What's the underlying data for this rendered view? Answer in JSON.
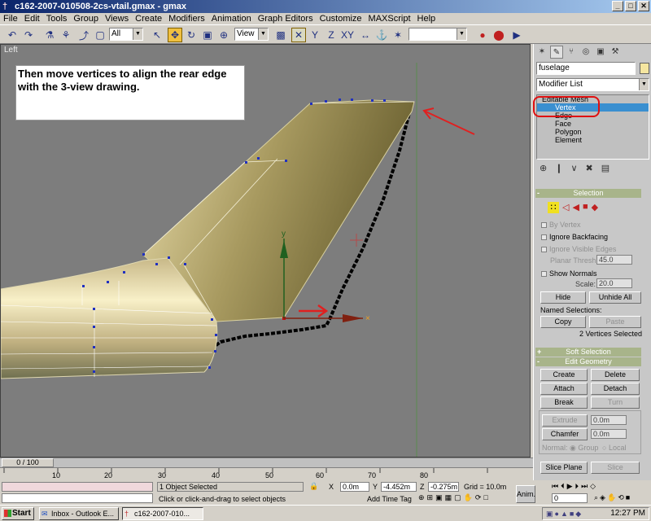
{
  "window": {
    "title": "c162-2007-010508-2cs-vtail.gmax - gmax",
    "app_icon": "gmax-icon"
  },
  "menu": [
    "File",
    "Edit",
    "Tools",
    "Group",
    "Views",
    "Create",
    "Modifiers",
    "Animation",
    "Graph Editors",
    "Customize",
    "MAXScript",
    "Help"
  ],
  "toolbar": {
    "selection_filter": "All",
    "ref_coord": "View",
    "named_set": ""
  },
  "viewport": {
    "label": "Left",
    "callout": "Then move vertices to align the rear edge with the 3-view drawing."
  },
  "command_panel": {
    "object_name": "fuselage",
    "object_color": "#f5e6a0",
    "modifier_list": "Modifier List",
    "stack": {
      "root": "Editable Mesh",
      "items": [
        "Vertex",
        "Edge",
        "Face",
        "Polygon",
        "Element"
      ],
      "selected": "Vertex"
    },
    "selection": {
      "title": "Selection",
      "by_vertex": "By Vertex",
      "ignore_backfacing": "Ignore Backfacing",
      "ignore_visible_edges": "Ignore Visible Edges",
      "planar_thresh_label": "Planar Thresh:",
      "planar_thresh": "45.0",
      "show_normals": "Show Normals",
      "scale_label": "Scale:",
      "scale": "20.0",
      "hide": "Hide",
      "unhide_all": "Unhide All",
      "named_selections": "Named Selections:",
      "copy": "Copy",
      "paste": "Paste",
      "status": "2 Vertices Selected"
    },
    "soft_selection": "Soft Selection",
    "edit_geometry": {
      "title": "Edit Geometry",
      "create": "Create",
      "delete": "Delete",
      "attach": "Attach",
      "detach": "Detach",
      "break": "Break",
      "turn": "Turn",
      "extrude": "Extrude",
      "extrude_val": "0.0m",
      "chamfer": "Chamfer",
      "chamfer_val": "0.0m",
      "normal_label": "Normal:",
      "group": "Group",
      "local": "Local",
      "slice_plane": "Slice Plane",
      "slice": "Slice"
    }
  },
  "timeline": {
    "frame": "0 / 100",
    "ticks": [
      "10",
      "20",
      "30",
      "40",
      "50",
      "60",
      "70",
      "80"
    ]
  },
  "status": {
    "selected": "1 Object Selected",
    "prompt": "Click or click-and-drag to select objects",
    "x_label": "X",
    "x": "0.0m",
    "y_label": "Y",
    "y": "-4.452m",
    "z_label": "Z",
    "z": "-0.275m",
    "grid": "Grid = 10.0m",
    "add_time_tag": "Add Time Tag",
    "anim": "Anim.",
    "frame_field": "0"
  },
  "taskbar": {
    "start": "Start",
    "items": [
      "Inbox - Outlook E...",
      "c162-2007-010..."
    ],
    "clock": "12:27 PM"
  }
}
